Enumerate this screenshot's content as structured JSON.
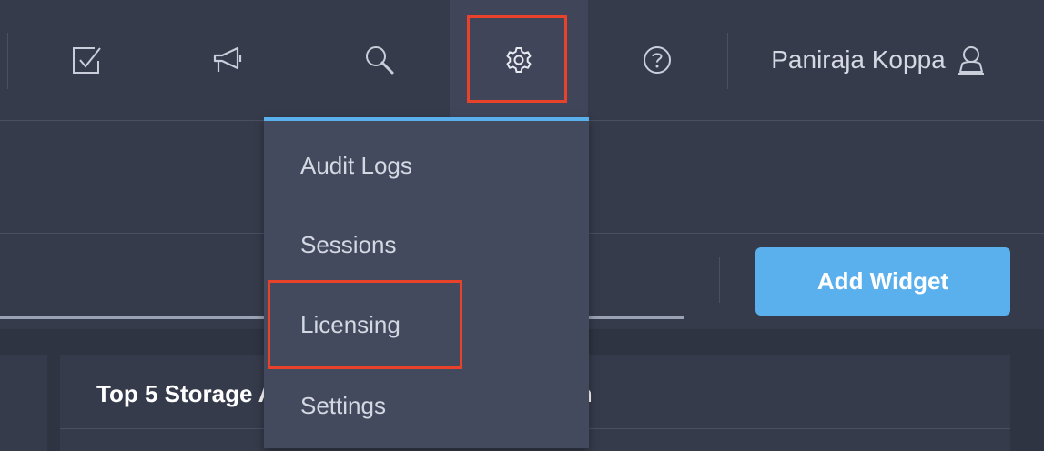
{
  "header": {
    "user_name": "Paniraja Koppa",
    "icons": [
      "checkbox-icon",
      "megaphone-icon",
      "search-icon",
      "gear-icon",
      "help-icon",
      "user-icon"
    ]
  },
  "settings_menu": {
    "items": [
      {
        "label": "Audit Logs"
      },
      {
        "label": "Sessions"
      },
      {
        "label": "Licensing"
      },
      {
        "label": "Settings"
      }
    ]
  },
  "toolbar": {
    "add_widget_label": "Add Widget"
  },
  "card": {
    "title": "Top 5 Storage Arrays by Capacity Utilization"
  },
  "colors": {
    "accent": "#5ab0ec",
    "highlight": "#e8432a",
    "header_bg": "#363b4b",
    "menu_bg": "#444a5e"
  }
}
